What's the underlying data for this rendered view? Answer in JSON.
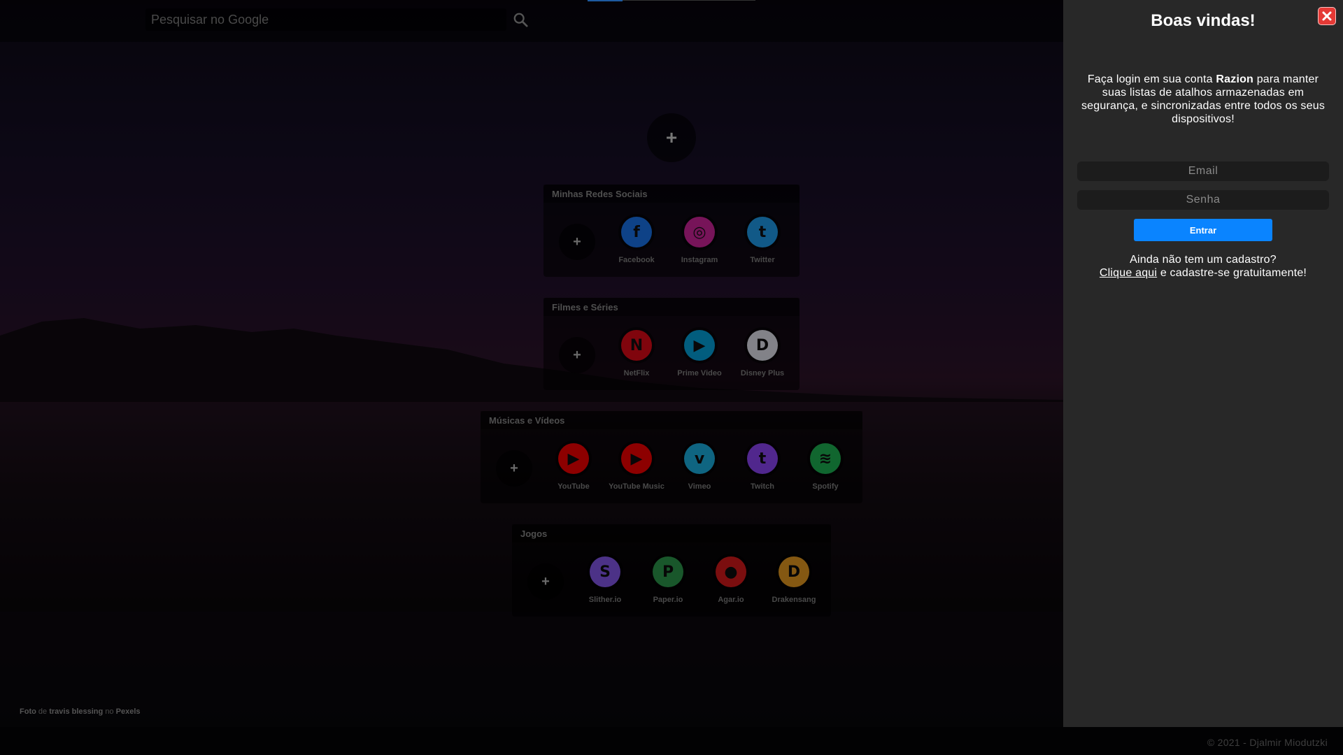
{
  "search": {
    "placeholder": "Pesquisar no Google"
  },
  "center_add": "+",
  "groups": [
    {
      "title": "Minhas Redes Sociais",
      "shortcuts": [
        {
          "label": "Facebook",
          "glyph": "f",
          "color": "#1877f2"
        },
        {
          "label": "Instagram",
          "glyph": "◎",
          "color": "#d6249f"
        },
        {
          "label": "Twitter",
          "glyph": "t",
          "color": "#1da1f2"
        }
      ]
    },
    {
      "title": "Filmes e Séries",
      "shortcuts": [
        {
          "label": "NetFlix",
          "glyph": "N",
          "color": "#e50914"
        },
        {
          "label": "Prime Video",
          "glyph": "▶",
          "color": "#00a8e1"
        },
        {
          "label": "Disney Plus",
          "glyph": "D",
          "color": "#e8ecf4"
        }
      ]
    },
    {
      "title": "Músicas e Vídeos",
      "shortcuts": [
        {
          "label": "YouTube",
          "glyph": "▶",
          "color": "#ff0000"
        },
        {
          "label": "YouTube Music",
          "glyph": "▶",
          "color": "#ff0000"
        },
        {
          "label": "Vimeo",
          "glyph": "v",
          "color": "#1ab7ea"
        },
        {
          "label": "Twitch",
          "glyph": "t",
          "color": "#9146ff"
        },
        {
          "label": "Spotify",
          "glyph": "≋",
          "color": "#1db954"
        }
      ]
    },
    {
      "title": "Jogos",
      "shortcuts": [
        {
          "label": "Slither.io",
          "glyph": "S",
          "color": "#8a5cf6"
        },
        {
          "label": "Paper.io",
          "glyph": "P",
          "color": "#2e9e4e"
        },
        {
          "label": "Agar.io",
          "glyph": "●",
          "color": "#e01b1b"
        },
        {
          "label": "Drakensang",
          "glyph": "D",
          "color": "#f0a020"
        }
      ]
    }
  ],
  "add_label": "+",
  "credit": {
    "prefix": "Foto",
    "de": "de",
    "author": "travis blessing",
    "no": "no",
    "site": "Pexels"
  },
  "copyright": "© 2021 - Djalmir Miodutzki",
  "login": {
    "title": "Boas vindas!",
    "intro_before": "Faça login em sua conta ",
    "brand": "Razion",
    "intro_after": " para manter suas listas de atalhos armazenadas em segurança, e sincronizadas entre todos os seus dispositivos!",
    "email_placeholder": "Email",
    "password_placeholder": "Senha",
    "submit": "Entrar",
    "signup_question": "Ainda não tem um cadastro?",
    "signup_link": "Clique aqui",
    "signup_rest": " e cadastre-se gratuitamente!"
  },
  "colors": {
    "accent": "#0a84ff",
    "close": "#e53935",
    "panel_bg": "#282828"
  }
}
